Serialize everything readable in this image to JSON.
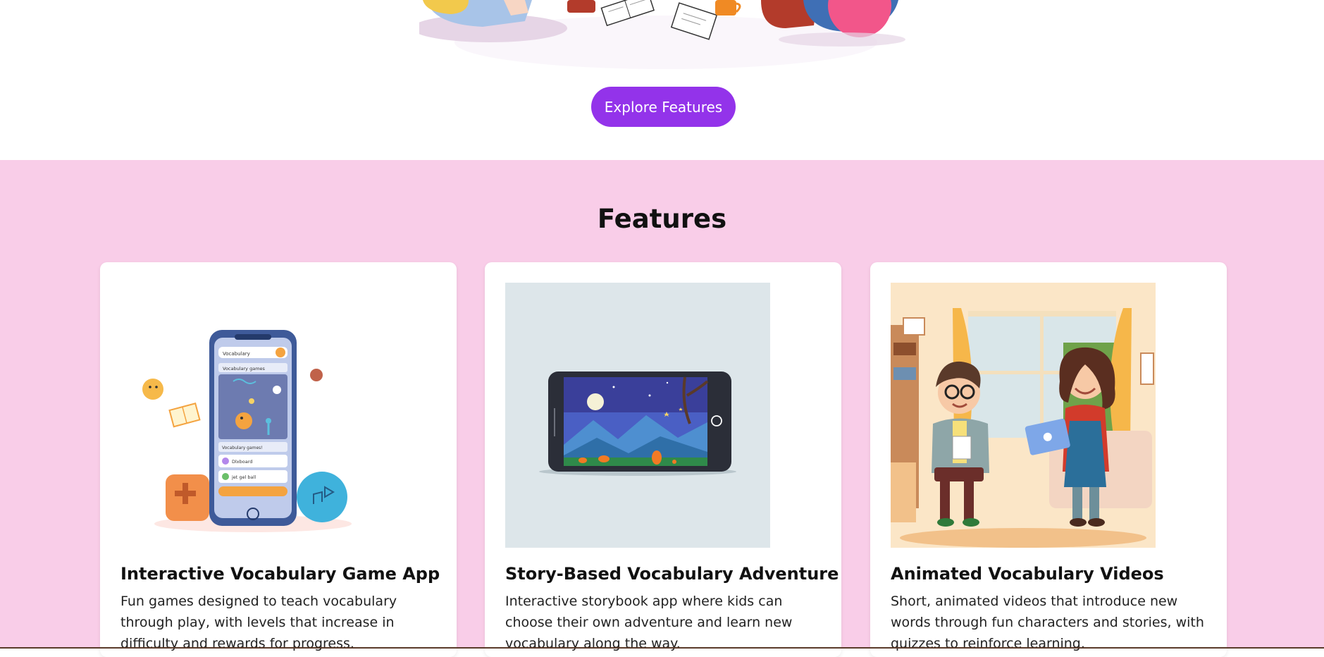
{
  "hero": {
    "cta_label": "Explore Features"
  },
  "features": {
    "title": "Features",
    "cards": [
      {
        "title": "Interactive Vocabulary Game App",
        "description": "Fun games designed to teach vocabulary through play, with levels that increase in difficulty and rewards for progress.",
        "phone_search_text": "Vocabulary",
        "phone_panel_title": "Vocabulary games",
        "phone_list_header": "Vocabulary games!",
        "phone_list_items": [
          "Dlxboard",
          "jet gel ball"
        ]
      },
      {
        "title": "Story-Based Vocabulary Adventure",
        "description": "Interactive storybook app where kids can choose their own adventure and learn new vocabulary along the way."
      },
      {
        "title": "Animated Vocabulary Videos",
        "description": "Short, animated videos that introduce new words through fun characters and stories, with quizzes to reinforce learning."
      }
    ]
  },
  "colors": {
    "accent": "#9333ea",
    "features_bg": "#f9cde8",
    "card_bg": "#ffffff"
  }
}
